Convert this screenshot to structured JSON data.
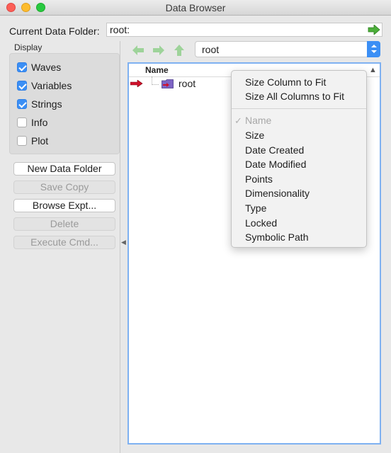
{
  "window": {
    "title": "Data Browser"
  },
  "current_folder": {
    "label": "Current Data Folder:",
    "value": "root:"
  },
  "display": {
    "label": "Display",
    "options": [
      {
        "label": "Waves",
        "checked": true
      },
      {
        "label": "Variables",
        "checked": true
      },
      {
        "label": "Strings",
        "checked": true
      },
      {
        "label": "Info",
        "checked": false
      },
      {
        "label": "Plot",
        "checked": false
      }
    ]
  },
  "buttons": [
    {
      "label": "New Data Folder",
      "enabled": true
    },
    {
      "label": "Save Copy",
      "enabled": false
    },
    {
      "label": "Browse Expt...",
      "enabled": true
    },
    {
      "label": "Delete",
      "enabled": false
    },
    {
      "label": "Execute Cmd...",
      "enabled": false
    }
  ],
  "folder_select": {
    "value": "root"
  },
  "list": {
    "column_header": "Name",
    "rows": [
      {
        "label": "root"
      }
    ]
  },
  "context_menu": {
    "items_top": [
      "Size Column to Fit",
      "Size All Columns to Fit"
    ],
    "columns": [
      {
        "label": "Name",
        "enabled": false,
        "checked": true
      },
      {
        "label": "Size",
        "enabled": true
      },
      {
        "label": "Date Created",
        "enabled": true
      },
      {
        "label": "Date Modified",
        "enabled": true
      },
      {
        "label": "Points",
        "enabled": true
      },
      {
        "label": "Dimensionality",
        "enabled": true
      },
      {
        "label": "Type",
        "enabled": true
      },
      {
        "label": "Locked",
        "enabled": true
      },
      {
        "label": "Symbolic Path",
        "enabled": true
      }
    ]
  },
  "colors": {
    "accent": "#3b8ff5",
    "nav_arrow": "#9ed39a",
    "go_arrow": "#4caf3a",
    "row_marker": "#d0112b"
  }
}
